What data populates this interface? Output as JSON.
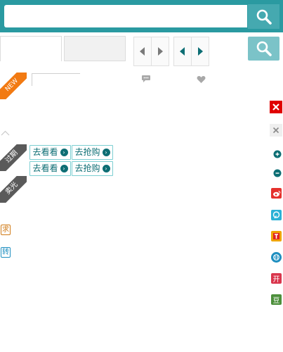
{
  "search": {
    "placeholder": ""
  },
  "ribbons": {
    "new": "NEW",
    "expired": "过期",
    "sold_out": "卖光"
  },
  "actions": {
    "row1": [
      "去看看",
      "去抢购"
    ],
    "row2": [
      "去看看",
      "去抢购"
    ]
  },
  "side_tags": {
    "ask": "求",
    "repost": "转"
  },
  "share": {
    "kaixin": "开",
    "douban": "豆"
  },
  "colors": {
    "brand": "#2a9aa1",
    "new_ribbon": "#f27a12",
    "gray_ribbon": "#5a5a5a",
    "close_red": "#e00000",
    "weibo": "#e5312d",
    "qzone": "#2bb1d6",
    "tencent": "#f0a300",
    "renren": "#1f8fc0",
    "kaixin": "#d9364d",
    "douban": "#4c8f3b"
  }
}
